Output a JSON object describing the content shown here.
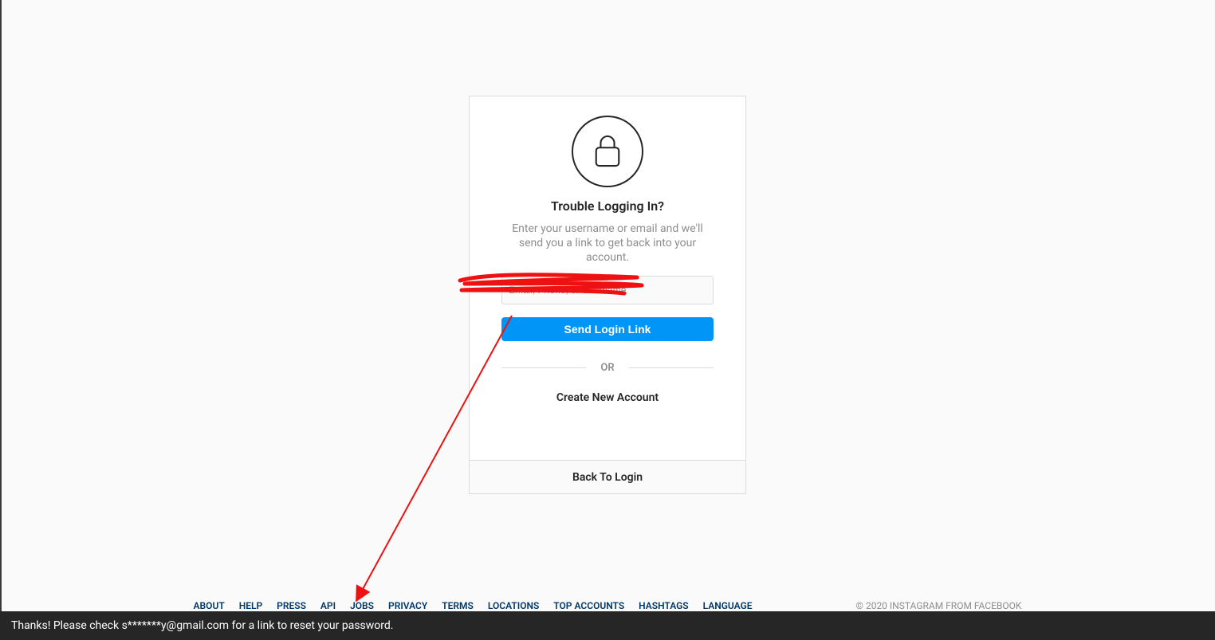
{
  "card": {
    "title": "Trouble Logging In?",
    "subtitle": "Enter your username or email and we'll send you a link to get back into your account.",
    "input_placeholder": "Email, Phone, or Username",
    "send_button": "Send Login Link",
    "or": "OR",
    "create_account": "Create New Account",
    "back": "Back To Login"
  },
  "footer": {
    "links": [
      "ABOUT",
      "HELP",
      "PRESS",
      "API",
      "JOBS",
      "PRIVACY",
      "TERMS",
      "LOCATIONS",
      "TOP ACCOUNTS",
      "HASHTAGS",
      "LANGUAGE"
    ],
    "copyright": "© 2020 INSTAGRAM FROM FACEBOOK"
  },
  "toast": {
    "message": "Thanks! Please check s*******y@gmail.com for a link to reset your password."
  }
}
